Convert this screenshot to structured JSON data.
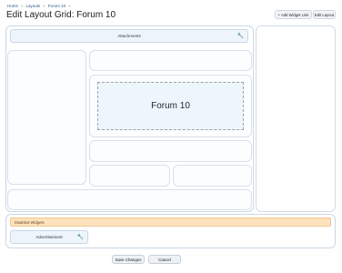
{
  "breadcrumb": {
    "items": [
      "Home",
      "Layouts",
      "Forum 10"
    ],
    "separator": "»"
  },
  "page": {
    "title": "Edit Layout Grid: Forum 10"
  },
  "toolbar": {
    "add_widget_label": "+ Add Widget Link",
    "edit_layout_label": "Edit Layout"
  },
  "grid": {
    "attachments_widget": "Attachments",
    "forum_placeholder": "Forum 10"
  },
  "disabled": {
    "header": "Disabled Widgets",
    "advertisement_widget": "Advertisement"
  },
  "actions": {
    "save_label": "Save Changes",
    "cancel_label": "Cancel"
  },
  "icons": {
    "widget_settings": "wrench-icon"
  }
}
